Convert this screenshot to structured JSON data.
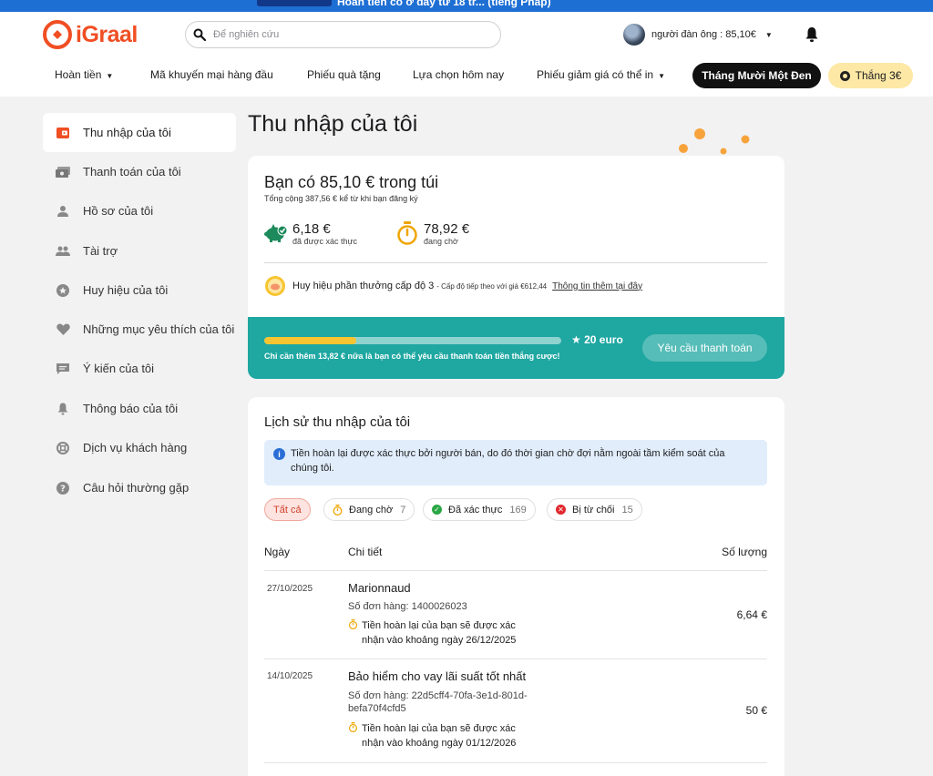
{
  "banner": {
    "text": "Hoàn tiền có ở đây từ 18 tr... (tiếng Pháp)"
  },
  "header": {
    "logo_text": "iGraal",
    "search_placeholder": "Để nghiên cứu",
    "user_label": "người đàn ông : 85,10€"
  },
  "nav": {
    "items": [
      "Hoàn tiền",
      "Mã khuyến mại hàng đầu",
      "Phiếu quà tặng",
      "Lựa chọn hôm nay",
      "Phiếu giảm giá có thể in"
    ],
    "black_button": "Tháng Mười Một Đen",
    "yellow_button": "Thắng 3€"
  },
  "sidebar": {
    "items": [
      {
        "label": "Thu nhập của tôi",
        "icon": "wallet-icon",
        "active": true
      },
      {
        "label": "Thanh toán của tôi",
        "icon": "payment-icon"
      },
      {
        "label": "Hồ sơ của tôi",
        "icon": "person-icon"
      },
      {
        "label": "Tài trợ",
        "icon": "people-icon"
      },
      {
        "label": "Huy hiệu của tôi",
        "icon": "badge-icon"
      },
      {
        "label": "Những mục yêu thích của tôi",
        "icon": "heart-icon"
      },
      {
        "label": "Ý kiến của tôi",
        "icon": "comment-icon"
      },
      {
        "label": "Thông báo của tôi",
        "icon": "bell-icon"
      },
      {
        "label": "Dịch vụ khách hàng",
        "icon": "support-icon"
      },
      {
        "label": "Câu hỏi thường gặp",
        "icon": "help-icon"
      }
    ]
  },
  "main": {
    "title": "Thu nhập của tôi",
    "balance": {
      "headline": "Bạn có 85,10 € trong túi",
      "total": "Tổng cộng 387,56 € kể từ khi bạn đăng ký",
      "validated_amount": "6,18 €",
      "validated_label": "đã được xác thực",
      "pending_amount": "78,92 €",
      "pending_label": "đang chờ",
      "badge_text": "Huy hiệu phần thưởng cấp độ 3",
      "badge_next": "- Cấp độ tiếp theo với giá €612,44",
      "badge_link": "Thông tin thêm tại đây",
      "progress_fraction": 0.31,
      "goal": "20 euro",
      "progress_text": "Chỉ cần thêm 13,82 € nữa là bạn có thể yêu cầu thanh toán tiền thắng cược!",
      "pay_button": "Yêu cầu thanh toán"
    },
    "history": {
      "title": "Lịch sử thu nhập của tôi",
      "info": "Tiền hoàn lại được xác thực bởi người bán, do đó thời gian chờ đợi nằm ngoài tầm kiểm soát của chúng tôi.",
      "filters": {
        "all": "Tất cả",
        "pending": "Đang chờ",
        "pending_count": "7",
        "validated": "Đã xác thực",
        "validated_count": "169",
        "rejected": "Bị từ chối",
        "rejected_count": "15"
      },
      "columns": {
        "date": "Ngày",
        "details": "Chi tiết",
        "amount": "Số lượng"
      },
      "rows": [
        {
          "date": "27/10/2025",
          "merchant": "Marionnaud",
          "order": "Số đơn hàng: 1400026023",
          "note": "Tiền hoàn lại của bạn sẽ được xác nhận vào khoảng ngày 26/12/2025",
          "amount": "6,64 €"
        },
        {
          "date": "14/10/2025",
          "merchant": "Bảo hiểm cho vay lãi suất tốt nhất",
          "order": "Số đơn hàng: 22d5cff4-70fa-3e1d-801d-befa70f4cfd5",
          "note": "Tiền hoàn lại của bạn sẽ được xác nhận vào khoảng ngày 01/12/2026",
          "amount": "50 €"
        }
      ]
    }
  }
}
